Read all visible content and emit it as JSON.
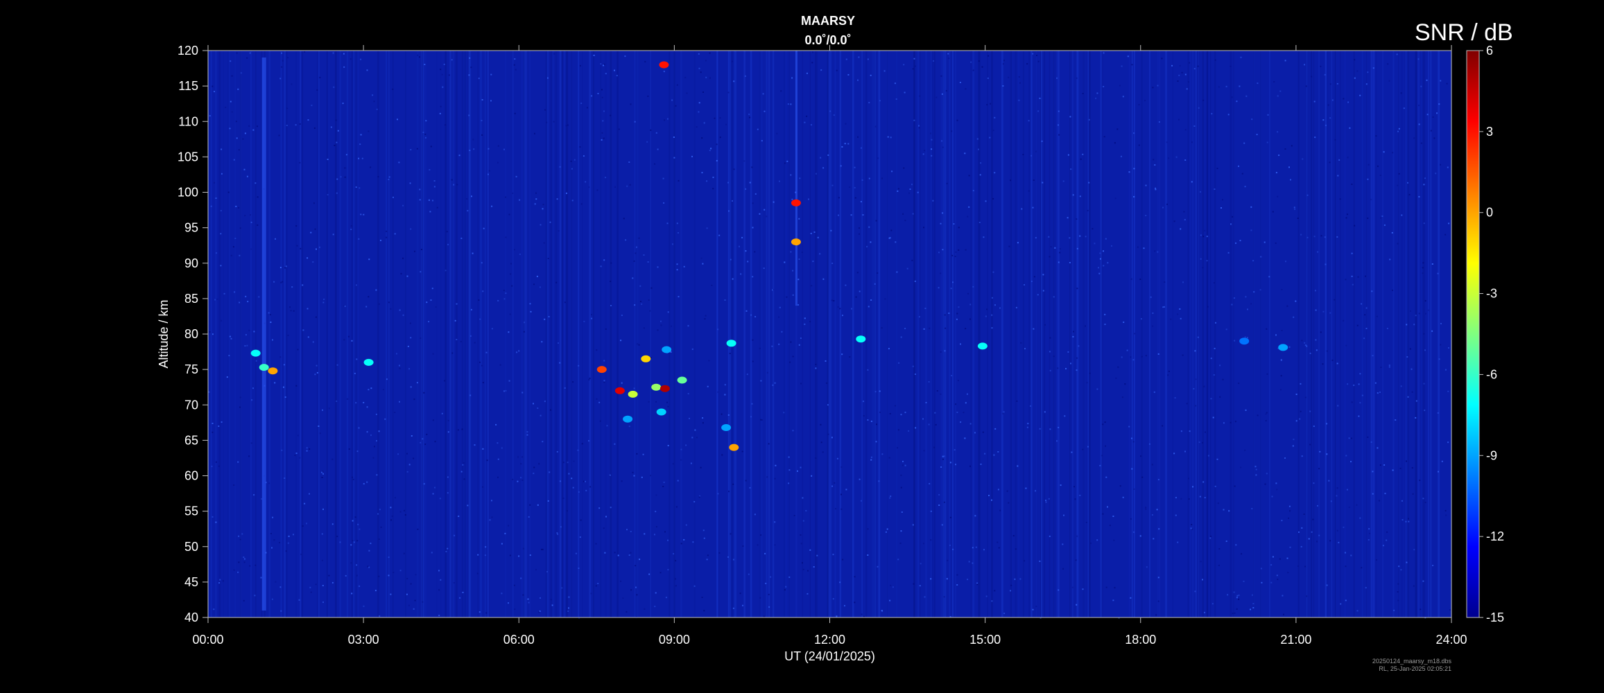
{
  "chart_data": {
    "type": "heatmap",
    "title": "MAARSY",
    "subtitle": "0.0˚/0.0˚",
    "xlabel": "UT (24/01/2025)",
    "ylabel": "Altitude / km",
    "xlim": [
      0,
      24
    ],
    "ylim": [
      40,
      120
    ],
    "x_ticks": [
      "00:00",
      "03:00",
      "06:00",
      "09:00",
      "12:00",
      "15:00",
      "18:00",
      "21:00",
      "24:00"
    ],
    "y_ticks": [
      "40",
      "45",
      "50",
      "55",
      "60",
      "65",
      "70",
      "75",
      "80",
      "85",
      "90",
      "95",
      "100",
      "105",
      "110",
      "115",
      "120"
    ],
    "colorbar": {
      "label": "SNR / dB",
      "range": [
        -15,
        6
      ],
      "ticks": [
        "6",
        "3",
        "0",
        "-3",
        "-6",
        "-9",
        "-12",
        "-15"
      ],
      "colormap": "jet"
    },
    "background_snr_db": -13,
    "echo_features": [
      {
        "time_h": 1.08,
        "altitude_km": 75.3,
        "snr_db": -6
      },
      {
        "time_h": 1.25,
        "altitude_km": 74.8,
        "snr_db": 0
      },
      {
        "time_h": 0.92,
        "altitude_km": 77.3,
        "snr_db": -7
      },
      {
        "time_h": 3.1,
        "altitude_km": 76.0,
        "snr_db": -7
      },
      {
        "time_h": 7.6,
        "altitude_km": 75.0,
        "snr_db": 2
      },
      {
        "time_h": 7.95,
        "altitude_km": 72.0,
        "snr_db": 4
      },
      {
        "time_h": 8.2,
        "altitude_km": 71.5,
        "snr_db": -3
      },
      {
        "time_h": 8.45,
        "altitude_km": 76.5,
        "snr_db": -1
      },
      {
        "time_h": 8.65,
        "altitude_km": 72.5,
        "snr_db": -4
      },
      {
        "time_h": 8.82,
        "altitude_km": 72.3,
        "snr_db": 5
      },
      {
        "time_h": 9.15,
        "altitude_km": 73.5,
        "snr_db": -5
      },
      {
        "time_h": 8.75,
        "altitude_km": 69.0,
        "snr_db": -8
      },
      {
        "time_h": 8.1,
        "altitude_km": 68.0,
        "snr_db": -9
      },
      {
        "time_h": 8.85,
        "altitude_km": 77.8,
        "snr_db": -9
      },
      {
        "time_h": 10.1,
        "altitude_km": 78.7,
        "snr_db": -7
      },
      {
        "time_h": 10.0,
        "altitude_km": 66.8,
        "snr_db": -9
      },
      {
        "time_h": 12.6,
        "altitude_km": 79.3,
        "snr_db": -7
      },
      {
        "time_h": 14.95,
        "altitude_km": 78.3,
        "snr_db": -7
      },
      {
        "time_h": 20.75,
        "altitude_km": 78.1,
        "snr_db": -9
      },
      {
        "time_h": 20.0,
        "altitude_km": 79.0,
        "snr_db": -10
      },
      {
        "time_h": 8.8,
        "altitude_km": 118.0,
        "snr_db": 3
      },
      {
        "time_h": 11.35,
        "altitude_km": 98.5,
        "snr_db": 3
      },
      {
        "time_h": 11.35,
        "altitude_km": 93.0,
        "snr_db": 0
      },
      {
        "time_h": 10.15,
        "altitude_km": 64.0,
        "snr_db": 0
      }
    ]
  },
  "footer": {
    "line1": "20250124_maarsy_m18.dbs",
    "line2": "RL, 25-Jan-2025 02:05:21"
  },
  "colors": {
    "background": "#000000",
    "plot_background": "#0a1ea8",
    "axis": "#bfbfbf",
    "text": "#ffffff"
  }
}
